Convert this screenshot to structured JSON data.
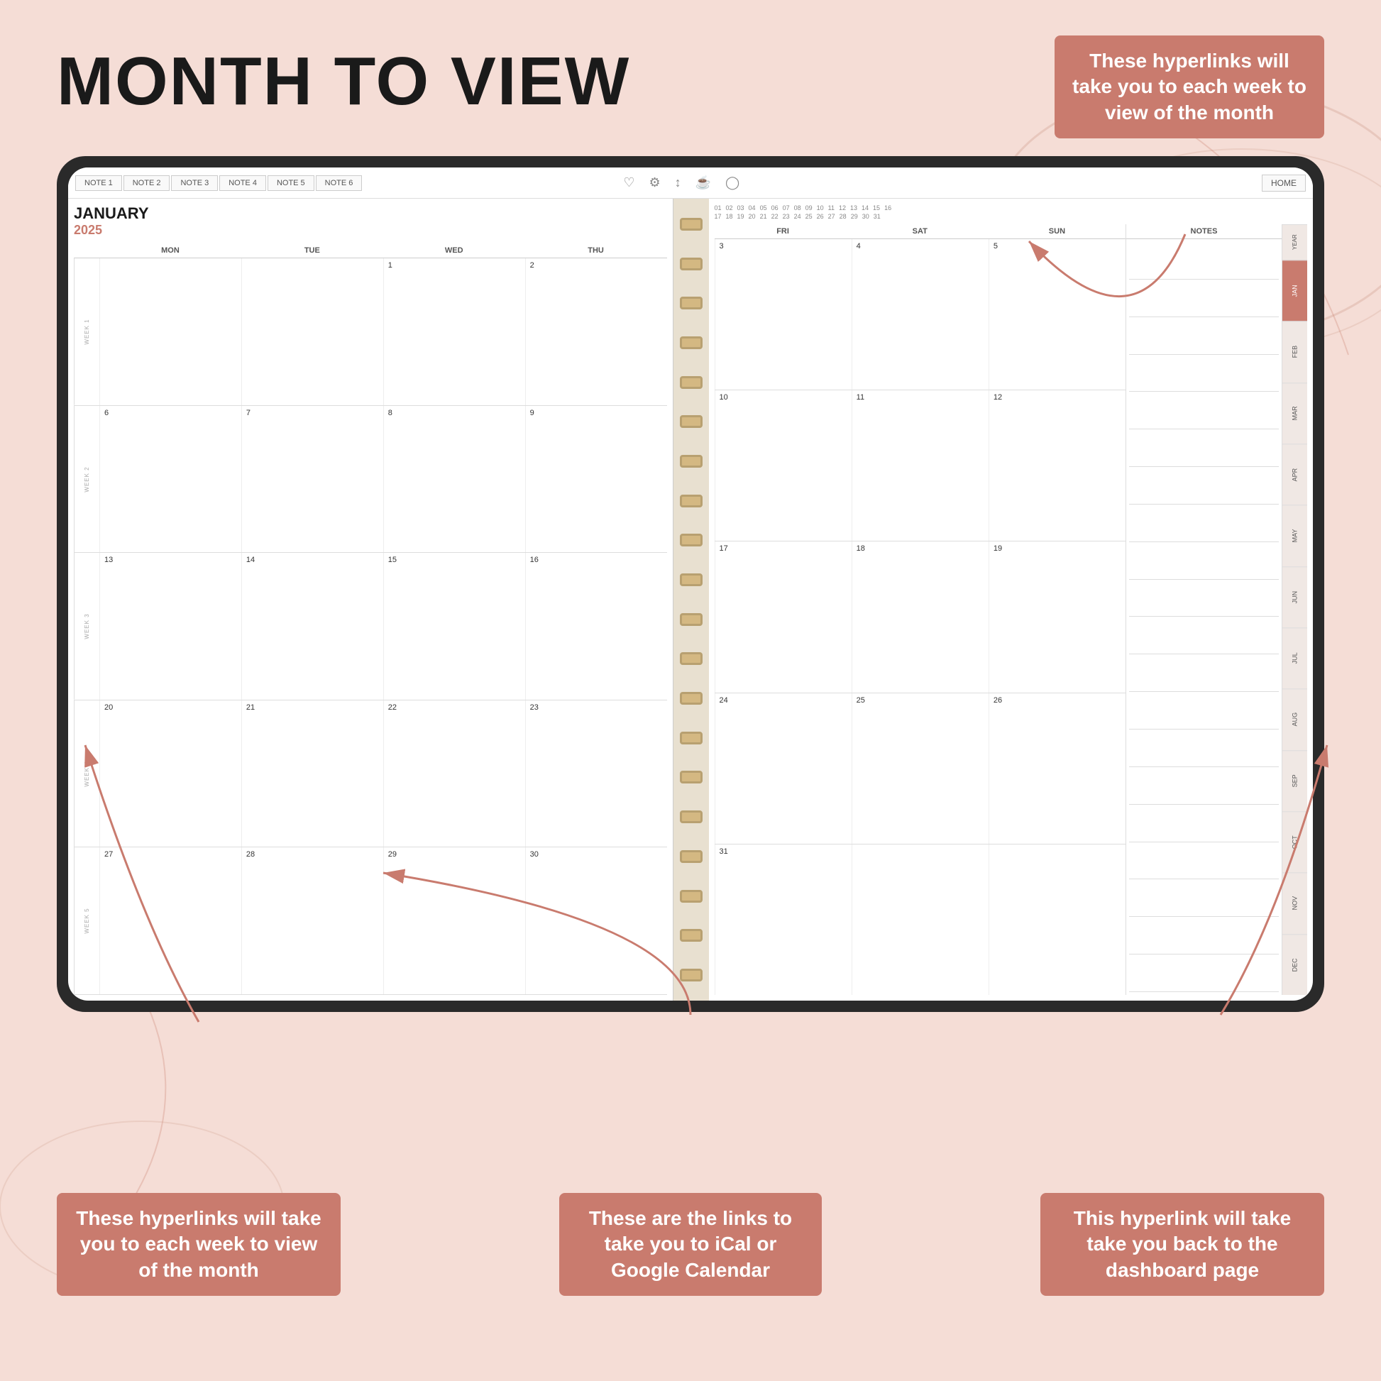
{
  "page": {
    "title": "MONTH TO VIEW",
    "background_color": "#f5ddd6"
  },
  "annotations": {
    "top_right": {
      "text": "These hyperlinks will take you to each week to view of the month"
    },
    "bottom_left": {
      "text": "These hyperlinks will take you to each week to view of the month"
    },
    "bottom_center": {
      "text": "These are the links to take you to iCal or Google Calendar"
    },
    "bottom_right": {
      "text": "This hyperlink will take take you back to the dashboard page"
    }
  },
  "planner": {
    "month": "JANUARY",
    "year": "2025",
    "nav_tabs": [
      "NOTE 1",
      "NOTE 2",
      "NOTE 3",
      "NOTE 4",
      "NOTE 5",
      "NOTE 6"
    ],
    "nav_icons": [
      "♡",
      "⚙",
      "↕",
      "☕",
      "◯"
    ],
    "home_label": "HOME",
    "day_headers_left": [
      "MON",
      "TUE",
      "WED",
      "THU"
    ],
    "day_headers_right": [
      "FRI",
      "SAT",
      "SUN"
    ],
    "weeks": [
      {
        "label": "WEEK 1",
        "left_days": [
          "",
          "",
          "1",
          "2"
        ],
        "right_days": [
          "3",
          "4",
          "5"
        ]
      },
      {
        "label": "WEEK 2",
        "left_days": [
          "6",
          "7",
          "8",
          "9"
        ],
        "right_days": [
          "10",
          "11",
          "12"
        ]
      },
      {
        "label": "WEEK 3",
        "left_days": [
          "13",
          "14",
          "15",
          "16"
        ],
        "right_days": [
          "17",
          "18",
          "19"
        ]
      },
      {
        "label": "WEEK 4",
        "left_days": [
          "20",
          "21",
          "22",
          "23"
        ],
        "right_days": [
          "24",
          "25",
          "26"
        ]
      },
      {
        "label": "WEEK 5",
        "left_days": [
          "27",
          "28",
          "29",
          "30"
        ],
        "right_days": [
          "31",
          "",
          ""
        ]
      }
    ],
    "top_numbers_row1": [
      "01",
      "02",
      "03",
      "04",
      "05",
      "06",
      "07",
      "08",
      "09",
      "10",
      "11",
      "12",
      "13",
      "14",
      "15",
      "16"
    ],
    "top_numbers_row2": [
      "17",
      "18",
      "19",
      "20",
      "21",
      "22",
      "23",
      "24",
      "25",
      "26",
      "27",
      "28",
      "29",
      "30",
      "31"
    ],
    "sidebar_months": [
      "YEAR",
      "JAN",
      "FEB",
      "MAR",
      "APR",
      "MAY",
      "JUN",
      "JUL",
      "AUG",
      "SEP",
      "OCT",
      "NOV",
      "DEC"
    ],
    "active_month": "JAN",
    "notes_label": "NOTES"
  }
}
